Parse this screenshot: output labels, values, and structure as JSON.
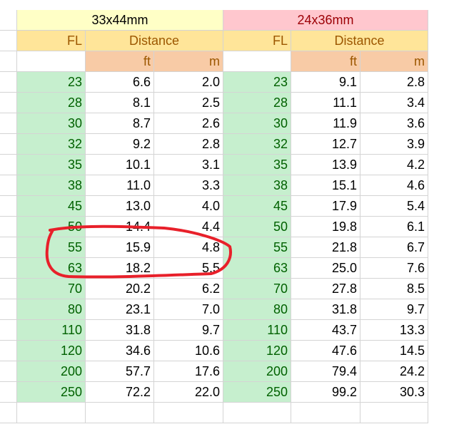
{
  "headers": {
    "group_left": "33x44mm",
    "group_right": "24x36mm",
    "fl": "FL",
    "distance": "Distance",
    "ft": "ft",
    "m": "m"
  },
  "rows": [
    {
      "fl": "23",
      "ft_a": "6.6",
      "m_a": "2.0",
      "fl_b": "23",
      "ft_b": "9.1",
      "m_b": "2.8"
    },
    {
      "fl": "28",
      "ft_a": "8.1",
      "m_a": "2.5",
      "fl_b": "28",
      "ft_b": "11.1",
      "m_b": "3.4"
    },
    {
      "fl": "30",
      "ft_a": "8.7",
      "m_a": "2.6",
      "fl_b": "30",
      "ft_b": "11.9",
      "m_b": "3.6"
    },
    {
      "fl": "32",
      "ft_a": "9.2",
      "m_a": "2.8",
      "fl_b": "32",
      "ft_b": "12.7",
      "m_b": "3.9"
    },
    {
      "fl": "35",
      "ft_a": "10.1",
      "m_a": "3.1",
      "fl_b": "35",
      "ft_b": "13.9",
      "m_b": "4.2"
    },
    {
      "fl": "38",
      "ft_a": "11.0",
      "m_a": "3.3",
      "fl_b": "38",
      "ft_b": "15.1",
      "m_b": "4.6"
    },
    {
      "fl": "45",
      "ft_a": "13.0",
      "m_a": "4.0",
      "fl_b": "45",
      "ft_b": "17.9",
      "m_b": "5.4"
    },
    {
      "fl": "50",
      "ft_a": "14.4",
      "m_a": "4.4",
      "fl_b": "50",
      "ft_b": "19.8",
      "m_b": "6.1"
    },
    {
      "fl": "55",
      "ft_a": "15.9",
      "m_a": "4.8",
      "fl_b": "55",
      "ft_b": "21.8",
      "m_b": "6.7"
    },
    {
      "fl": "63",
      "ft_a": "18.2",
      "m_a": "5.5",
      "fl_b": "63",
      "ft_b": "25.0",
      "m_b": "7.6"
    },
    {
      "fl": "70",
      "ft_a": "20.2",
      "m_a": "6.2",
      "fl_b": "70",
      "ft_b": "27.8",
      "m_b": "8.5"
    },
    {
      "fl": "80",
      "ft_a": "23.1",
      "m_a": "7.0",
      "fl_b": "80",
      "ft_b": "31.8",
      "m_b": "9.7"
    },
    {
      "fl": "110",
      "ft_a": "31.8",
      "m_a": "9.7",
      "fl_b": "110",
      "ft_b": "43.7",
      "m_b": "13.3"
    },
    {
      "fl": "120",
      "ft_a": "34.6",
      "m_a": "10.6",
      "fl_b": "120",
      "ft_b": "47.6",
      "m_b": "14.5"
    },
    {
      "fl": "200",
      "ft_a": "57.7",
      "m_a": "17.6",
      "fl_b": "200",
      "ft_b": "79.4",
      "m_b": "24.2"
    },
    {
      "fl": "250",
      "ft_a": "72.2",
      "m_a": "22.0",
      "fl_b": "250",
      "ft_b": "99.2",
      "m_b": "30.3"
    }
  ],
  "colors": {
    "fl_fill": "#c6efce",
    "fl_text": "#006100",
    "annotation": "#e8202a"
  }
}
